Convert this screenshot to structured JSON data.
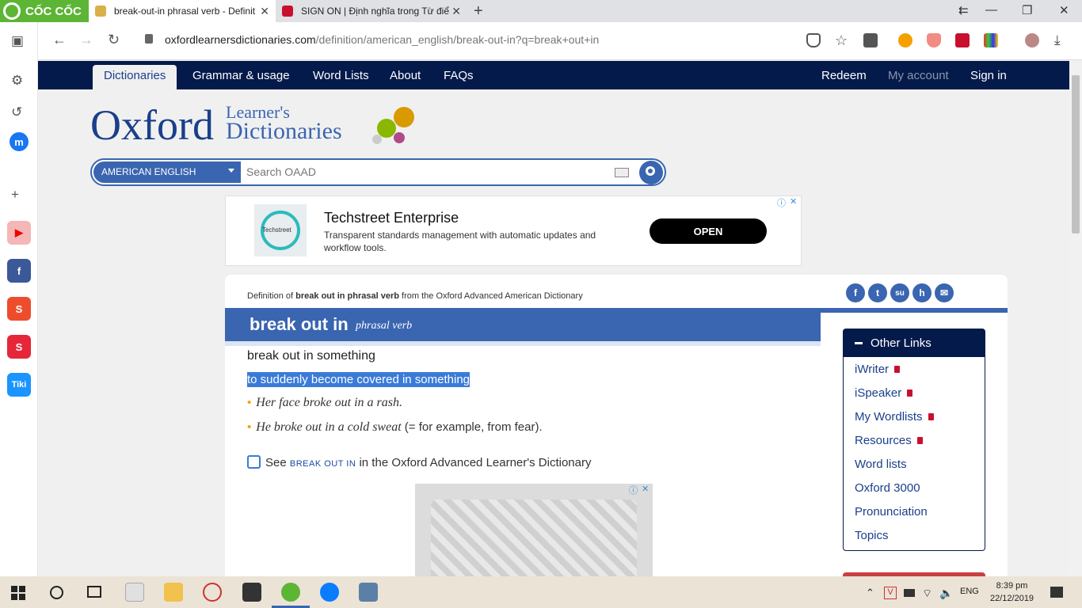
{
  "browser": {
    "brand": "CỐC CỐC",
    "tabs": [
      {
        "title": "break-out-in phrasal verb - Definit",
        "active": true
      },
      {
        "title": "SIGN ON | Định nghĩa trong Từ điể",
        "active": false
      }
    ],
    "new_tab": "+",
    "window_controls": {
      "pin": "⇇",
      "minimize": "—",
      "maximize": "❐",
      "close": "✕"
    },
    "url": {
      "domain": "oxfordlearnersdictionaries.com",
      "path": "/definition/american_english/break-out-in?q=break+out+in"
    },
    "nav": {
      "back": "←",
      "forward": "→",
      "reload": "↻"
    },
    "sidebar": [
      {
        "name": "settings",
        "glyph": "⚙"
      },
      {
        "name": "history",
        "glyph": "↺"
      },
      {
        "name": "messenger",
        "glyph": "m"
      },
      {
        "name": "add",
        "glyph": "+"
      },
      {
        "name": "youtube",
        "glyph": "▶"
      },
      {
        "name": "facebook",
        "glyph": "f"
      },
      {
        "name": "shopee",
        "glyph": "S"
      },
      {
        "name": "app-red",
        "glyph": "S"
      },
      {
        "name": "tiki",
        "glyph": "Tiki"
      }
    ]
  },
  "site": {
    "nav": {
      "dictionaries": "Dictionaries",
      "grammar": "Grammar & usage",
      "wordlists": "Word Lists",
      "about": "About",
      "faqs": "FAQs",
      "redeem": "Redeem",
      "account": "My account",
      "signin": "Sign in"
    },
    "logo": {
      "oxford": "Oxford",
      "learners": "Learner's",
      "dictionaries": "Dictionaries"
    },
    "search": {
      "language": "AMERICAN ENGLISH",
      "placeholder": "Search OAAD"
    }
  },
  "ad_top": {
    "title": "Techstreet Enterprise",
    "desc": "Transparent standards management with automatic updates and workflow tools.",
    "cta": "OPEN",
    "brand": "Techstreet"
  },
  "entry": {
    "definition_of": {
      "pre": "Definition of ",
      "term": "break out in phrasal verb",
      "post": " from the Oxford Advanced American Dictionary"
    },
    "headword": "break out in",
    "pos": "phrasal verb",
    "pattern": "break out in something",
    "definition": "to suddenly become covered in something",
    "examples": [
      {
        "italic": "Her face broke out in a rash.",
        "extra": ""
      },
      {
        "italic": "He broke out in a cold sweat",
        "extra": " (= for example, from fear)."
      }
    ],
    "see": {
      "pre": "See ",
      "link": "BREAK OUT IN",
      "post": " in the Oxford Advanced Learner's Dictionary"
    },
    "social": [
      "f",
      "t",
      "su",
      "h",
      "✉"
    ]
  },
  "other_links": {
    "title": "Other Links",
    "items": [
      {
        "label": "iWriter",
        "locked": true
      },
      {
        "label": "iSpeaker",
        "locked": true
      },
      {
        "label": "My Wordlists",
        "locked": true
      },
      {
        "label": "Resources",
        "locked": true
      },
      {
        "label": "Word lists",
        "locked": false
      },
      {
        "label": "Oxford 3000",
        "locked": false
      },
      {
        "label": "Pronunciation",
        "locked": false
      },
      {
        "label": "Topics",
        "locked": false
      }
    ]
  },
  "taskbar": {
    "lang": "ENG",
    "time": "8:39 pm",
    "date": "22/12/2019"
  },
  "colors": {
    "navy": "#041a4b",
    "blue": "#3a65b0",
    "highlight": "#3a7bd8",
    "brand_green": "#5db536"
  }
}
